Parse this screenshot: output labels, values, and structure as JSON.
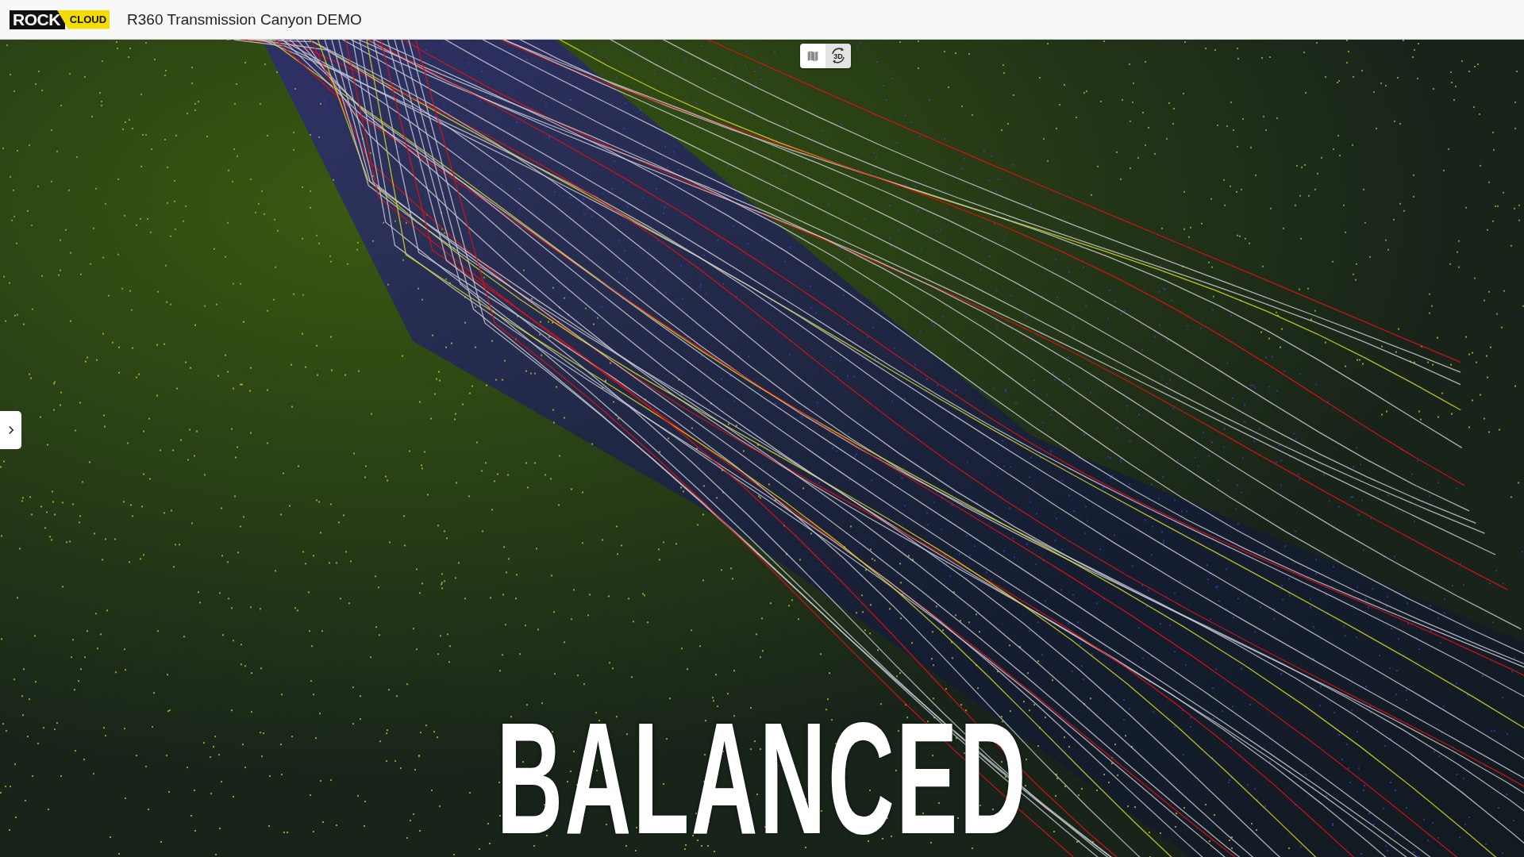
{
  "header": {
    "logo": {
      "word_1": "ROCK",
      "word_2": "CLOUD"
    },
    "title": "R360 Transmission Canyon DEMO"
  },
  "view_toggle": [
    {
      "kind": "map",
      "selected": false
    },
    {
      "kind": "orbit",
      "label": "3D",
      "selected": true
    }
  ],
  "caption": "BALANCED"
}
